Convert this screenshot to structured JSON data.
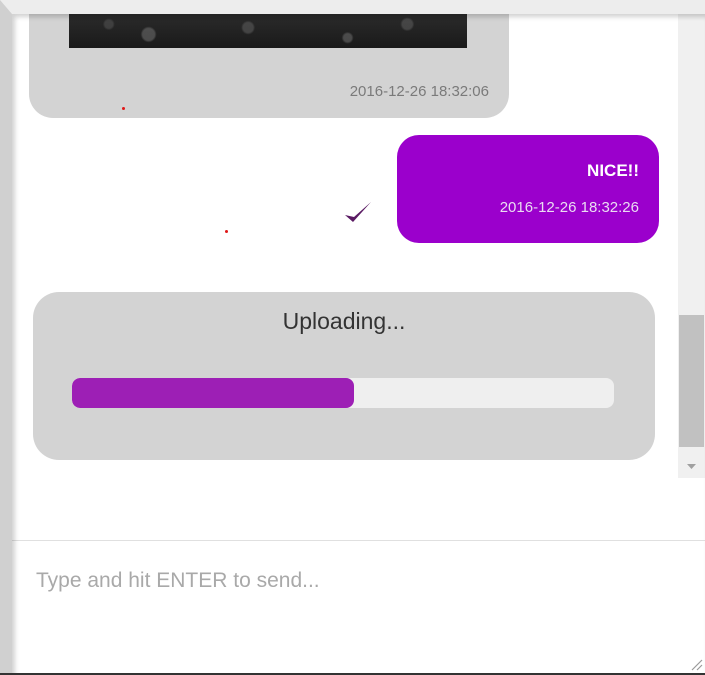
{
  "messages": {
    "incoming": {
      "timestamp": "2016-12-26 18:32:06",
      "image": "photo-thumbnail"
    },
    "outgoing": {
      "text": "NICE!!",
      "timestamp": "2016-12-26 18:32:26",
      "status_icon": "checkmark-icon"
    },
    "upload": {
      "label": "Uploading...",
      "progress_percent": 52
    }
  },
  "composer": {
    "placeholder": "Type and hit ENTER to send...",
    "value": ""
  },
  "colors": {
    "accent": "#9b00cc",
    "progress_fill": "#9d1fb5",
    "bubble_incoming": "#d3d3d3",
    "progress_track": "#efefef"
  },
  "icons": [
    "checkmark-icon",
    "scroll-down-arrow-icon",
    "resize-grip-icon"
  ]
}
